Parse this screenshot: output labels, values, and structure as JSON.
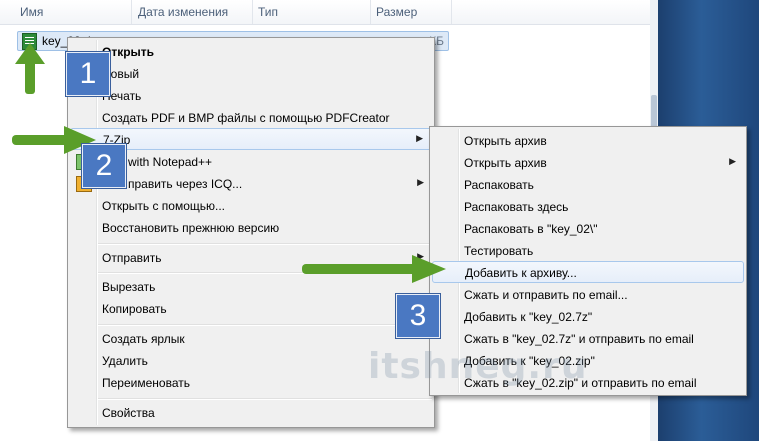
{
  "explorer": {
    "columns": [
      "Имя",
      "Дата изменения",
      "Тип",
      "Размер"
    ],
    "file": {
      "name": "key_02.d",
      "size": "КБ"
    }
  },
  "context_menu": {
    "items": [
      {
        "label": "Открыть",
        "bold": true
      },
      {
        "label": "Новый"
      },
      {
        "label": "Печать"
      },
      {
        "label": "Создать PDF и BMP файлы с помощью PDFCreator"
      },
      {
        "label": "7-Zip",
        "submenu": true
      },
      {
        "label": "with Notepad++"
      },
      {
        "label": "править через ICQ...",
        "submenu": true
      },
      {
        "label": "Открыть с помощью..."
      },
      {
        "label": "Восстановить прежнюю версию"
      },
      {
        "label": "Отправить",
        "submenu": true
      },
      {
        "label": "Вырезать"
      },
      {
        "label": "Копировать"
      },
      {
        "label": "Создать ярлык"
      },
      {
        "label": "Удалить"
      },
      {
        "label": "Переименовать"
      },
      {
        "label": "Свойства"
      }
    ]
  },
  "zip_submenu": {
    "items": [
      {
        "label": "Открыть архив"
      },
      {
        "label": "Открыть архив",
        "submenu": true
      },
      {
        "label": "Распаковать"
      },
      {
        "label": "Распаковать здесь"
      },
      {
        "label": "Распаковать в \"key_02\\\""
      },
      {
        "label": "Тестировать"
      },
      {
        "label": "Добавить к архиву...",
        "highlighted": true
      },
      {
        "label": "Сжать и отправить по email..."
      },
      {
        "label": "Добавить к \"key_02.7z\""
      },
      {
        "label": "Сжать в \"key_02.7z\" и отправить по email"
      },
      {
        "label": "Добавить к \"key_02.zip\""
      },
      {
        "label": "Сжать в \"key_02.zip\" и отправить по email"
      }
    ]
  },
  "annotations": {
    "step1": "1",
    "step2": "2",
    "step3": "3",
    "arrow_color": "#5a9e2a",
    "badge_color": "#4a78c2"
  },
  "watermark": "itshneg.ru"
}
